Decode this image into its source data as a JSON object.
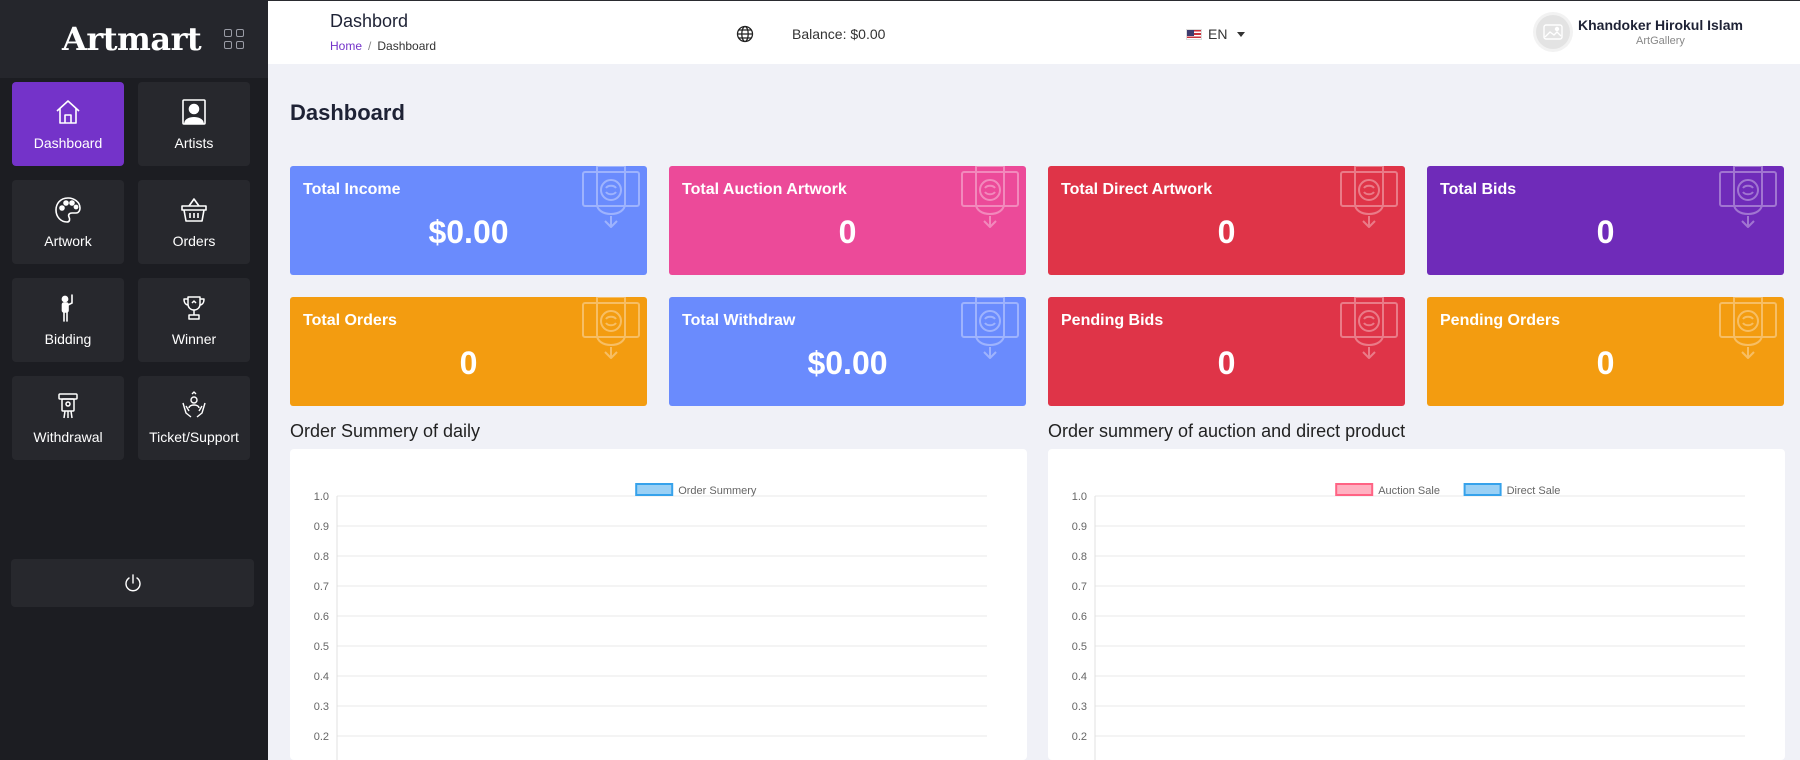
{
  "sidebar": {
    "brand": "Artmart",
    "items": [
      {
        "label": "Dashboard",
        "icon": "home-icon",
        "active": true
      },
      {
        "label": "Artists",
        "icon": "portrait-icon",
        "active": false
      },
      {
        "label": "Artwork",
        "icon": "palette-icon",
        "active": false
      },
      {
        "label": "Orders",
        "icon": "basket-icon",
        "active": false
      },
      {
        "label": "Bidding",
        "icon": "person-raising-hand-icon",
        "active": false
      },
      {
        "label": "Winner",
        "icon": "trophy-icon",
        "active": false
      },
      {
        "label": "Withdrawal",
        "icon": "atm-withdraw-icon",
        "active": false
      },
      {
        "label": "Ticket/Support",
        "icon": "support-hands-icon",
        "active": false
      }
    ],
    "logout_icon": "power-icon"
  },
  "header": {
    "title": "Dashbord",
    "breadcrumb": {
      "home": "Home",
      "separator": "/",
      "current": "Dashboard"
    },
    "balance": "Balance: $0.00",
    "language": "EN",
    "user": {
      "name": "Khandoker Hirokul Islam",
      "role": "ArtGallery"
    }
  },
  "page_title": "Dashboard",
  "cards": [
    {
      "title": "Total Income",
      "value": "$0.00",
      "color": "#6a8bfd"
    },
    {
      "title": "Total Auction Artwork",
      "value": "0",
      "color": "#ec4a99"
    },
    {
      "title": "Total Direct Artwork",
      "value": "0",
      "color": "#df3448"
    },
    {
      "title": "Total Bids",
      "value": "0",
      "color": "#6f2bb9"
    },
    {
      "title": "Total Orders",
      "value": "0",
      "color": "#f39c10"
    },
    {
      "title": "Total Withdraw",
      "value": "$0.00",
      "color": "#6a8bfd"
    },
    {
      "title": "Pending Bids",
      "value": "0",
      "color": "#df3448"
    },
    {
      "title": "Pending Orders",
      "value": "0",
      "color": "#f39c10"
    }
  ],
  "charts": {
    "daily_title": "Order Summery of daily",
    "auction_title": "Order summery of auction and direct product"
  },
  "chart_data": [
    {
      "type": "bar",
      "title": "",
      "series": [
        {
          "name": "Order Summery",
          "values": [],
          "color": "#36a2eb"
        }
      ],
      "categories": [],
      "ylim": [
        0,
        1
      ],
      "yticks": [
        "1.0",
        "0.9",
        "0.8",
        "0.7",
        "0.6",
        "0.5",
        "0.4",
        "0.3",
        "0.2"
      ],
      "legend": "top-center",
      "grid": true
    },
    {
      "type": "bar",
      "title": "",
      "series": [
        {
          "name": "Auction Sale",
          "values": [],
          "color": "#ff6384"
        },
        {
          "name": "Direct Sale",
          "values": [],
          "color": "#36a2eb"
        }
      ],
      "categories": [],
      "ylim": [
        0,
        1
      ],
      "yticks": [
        "1.0",
        "0.9",
        "0.8",
        "0.7",
        "0.6",
        "0.5",
        "0.4",
        "0.3",
        "0.2"
      ],
      "legend": "top-center",
      "grid": true
    }
  ]
}
